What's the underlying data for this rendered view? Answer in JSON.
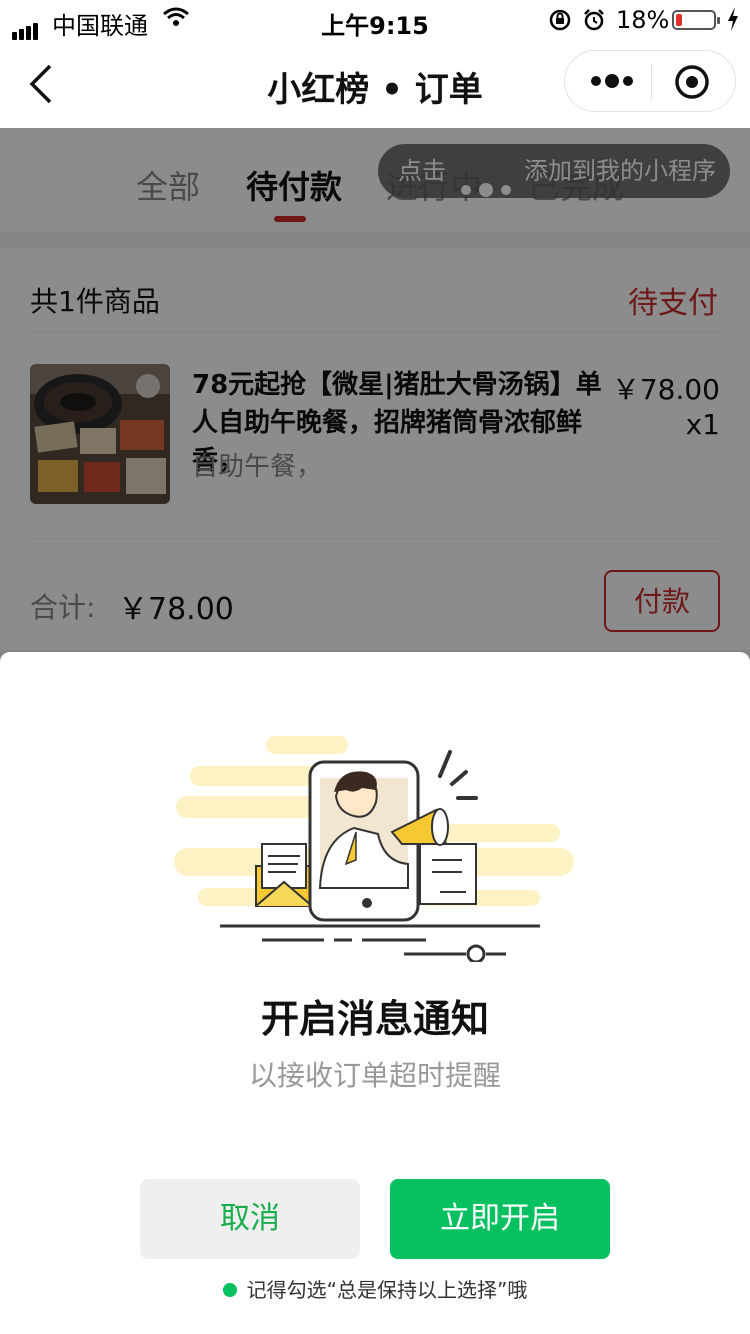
{
  "status_bar": {
    "carrier": "中国联通",
    "time": "上午9:15",
    "battery": "18%",
    "battery_level": 0.18
  },
  "nav": {
    "title": "小红榜 • 订单"
  },
  "tabs": [
    {
      "label": "全部",
      "active": false
    },
    {
      "label": "待付款",
      "active": true
    },
    {
      "label": "进行中",
      "active": false
    },
    {
      "label": "已完成",
      "active": false
    }
  ],
  "tip": {
    "prefix": "点击",
    "suffix": "添加到我的小程序"
  },
  "order": {
    "item_count": "共1件商品",
    "status": "待支付",
    "product_name": "78元起抢【微星|猪肚大骨汤锅】单人自助午晚餐，招牌猪筒骨浓郁鲜香，",
    "product_desc": "自助午餐，",
    "price": "￥78.00",
    "quantity": "x1",
    "total_label": "合计:",
    "total": "￥78.00",
    "pay_label": "付款"
  },
  "dialog": {
    "heading": "开启消息通知",
    "subheading": "以接收订单超时提醒",
    "cancel_label": "取消",
    "confirm_label": "立即开启",
    "reminder": "记得勾选“总是保持以上选择”哦"
  },
  "colors": {
    "accent_red": "#c82c2c",
    "wechat_green": "#07c160"
  }
}
